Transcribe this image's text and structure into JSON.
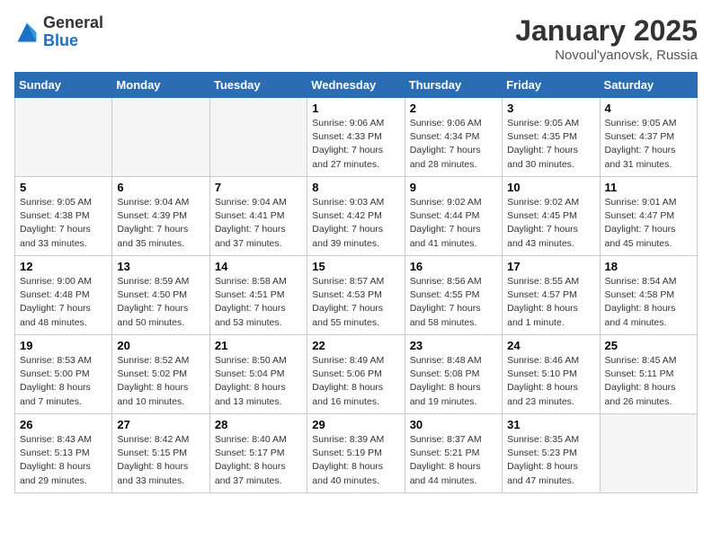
{
  "header": {
    "logo": {
      "line1": "General",
      "line2": "Blue"
    },
    "month_year": "January 2025",
    "location": "Novoul'yanovsk, Russia"
  },
  "weekdays": [
    "Sunday",
    "Monday",
    "Tuesday",
    "Wednesday",
    "Thursday",
    "Friday",
    "Saturday"
  ],
  "weeks": [
    [
      {
        "day": "",
        "empty": true
      },
      {
        "day": "",
        "empty": true
      },
      {
        "day": "",
        "empty": true
      },
      {
        "day": "1",
        "sunrise": "Sunrise: 9:06 AM",
        "sunset": "Sunset: 4:33 PM",
        "daylight": "Daylight: 7 hours and 27 minutes."
      },
      {
        "day": "2",
        "sunrise": "Sunrise: 9:06 AM",
        "sunset": "Sunset: 4:34 PM",
        "daylight": "Daylight: 7 hours and 28 minutes."
      },
      {
        "day": "3",
        "sunrise": "Sunrise: 9:05 AM",
        "sunset": "Sunset: 4:35 PM",
        "daylight": "Daylight: 7 hours and 30 minutes."
      },
      {
        "day": "4",
        "sunrise": "Sunrise: 9:05 AM",
        "sunset": "Sunset: 4:37 PM",
        "daylight": "Daylight: 7 hours and 31 minutes."
      }
    ],
    [
      {
        "day": "5",
        "sunrise": "Sunrise: 9:05 AM",
        "sunset": "Sunset: 4:38 PM",
        "daylight": "Daylight: 7 hours and 33 minutes."
      },
      {
        "day": "6",
        "sunrise": "Sunrise: 9:04 AM",
        "sunset": "Sunset: 4:39 PM",
        "daylight": "Daylight: 7 hours and 35 minutes."
      },
      {
        "day": "7",
        "sunrise": "Sunrise: 9:04 AM",
        "sunset": "Sunset: 4:41 PM",
        "daylight": "Daylight: 7 hours and 37 minutes."
      },
      {
        "day": "8",
        "sunrise": "Sunrise: 9:03 AM",
        "sunset": "Sunset: 4:42 PM",
        "daylight": "Daylight: 7 hours and 39 minutes."
      },
      {
        "day": "9",
        "sunrise": "Sunrise: 9:02 AM",
        "sunset": "Sunset: 4:44 PM",
        "daylight": "Daylight: 7 hours and 41 minutes."
      },
      {
        "day": "10",
        "sunrise": "Sunrise: 9:02 AM",
        "sunset": "Sunset: 4:45 PM",
        "daylight": "Daylight: 7 hours and 43 minutes."
      },
      {
        "day": "11",
        "sunrise": "Sunrise: 9:01 AM",
        "sunset": "Sunset: 4:47 PM",
        "daylight": "Daylight: 7 hours and 45 minutes."
      }
    ],
    [
      {
        "day": "12",
        "sunrise": "Sunrise: 9:00 AM",
        "sunset": "Sunset: 4:48 PM",
        "daylight": "Daylight: 7 hours and 48 minutes."
      },
      {
        "day": "13",
        "sunrise": "Sunrise: 8:59 AM",
        "sunset": "Sunset: 4:50 PM",
        "daylight": "Daylight: 7 hours and 50 minutes."
      },
      {
        "day": "14",
        "sunrise": "Sunrise: 8:58 AM",
        "sunset": "Sunset: 4:51 PM",
        "daylight": "Daylight: 7 hours and 53 minutes."
      },
      {
        "day": "15",
        "sunrise": "Sunrise: 8:57 AM",
        "sunset": "Sunset: 4:53 PM",
        "daylight": "Daylight: 7 hours and 55 minutes."
      },
      {
        "day": "16",
        "sunrise": "Sunrise: 8:56 AM",
        "sunset": "Sunset: 4:55 PM",
        "daylight": "Daylight: 7 hours and 58 minutes."
      },
      {
        "day": "17",
        "sunrise": "Sunrise: 8:55 AM",
        "sunset": "Sunset: 4:57 PM",
        "daylight": "Daylight: 8 hours and 1 minute."
      },
      {
        "day": "18",
        "sunrise": "Sunrise: 8:54 AM",
        "sunset": "Sunset: 4:58 PM",
        "daylight": "Daylight: 8 hours and 4 minutes."
      }
    ],
    [
      {
        "day": "19",
        "sunrise": "Sunrise: 8:53 AM",
        "sunset": "Sunset: 5:00 PM",
        "daylight": "Daylight: 8 hours and 7 minutes."
      },
      {
        "day": "20",
        "sunrise": "Sunrise: 8:52 AM",
        "sunset": "Sunset: 5:02 PM",
        "daylight": "Daylight: 8 hours and 10 minutes."
      },
      {
        "day": "21",
        "sunrise": "Sunrise: 8:50 AM",
        "sunset": "Sunset: 5:04 PM",
        "daylight": "Daylight: 8 hours and 13 minutes."
      },
      {
        "day": "22",
        "sunrise": "Sunrise: 8:49 AM",
        "sunset": "Sunset: 5:06 PM",
        "daylight": "Daylight: 8 hours and 16 minutes."
      },
      {
        "day": "23",
        "sunrise": "Sunrise: 8:48 AM",
        "sunset": "Sunset: 5:08 PM",
        "daylight": "Daylight: 8 hours and 19 minutes."
      },
      {
        "day": "24",
        "sunrise": "Sunrise: 8:46 AM",
        "sunset": "Sunset: 5:10 PM",
        "daylight": "Daylight: 8 hours and 23 minutes."
      },
      {
        "day": "25",
        "sunrise": "Sunrise: 8:45 AM",
        "sunset": "Sunset: 5:11 PM",
        "daylight": "Daylight: 8 hours and 26 minutes."
      }
    ],
    [
      {
        "day": "26",
        "sunrise": "Sunrise: 8:43 AM",
        "sunset": "Sunset: 5:13 PM",
        "daylight": "Daylight: 8 hours and 29 minutes."
      },
      {
        "day": "27",
        "sunrise": "Sunrise: 8:42 AM",
        "sunset": "Sunset: 5:15 PM",
        "daylight": "Daylight: 8 hours and 33 minutes."
      },
      {
        "day": "28",
        "sunrise": "Sunrise: 8:40 AM",
        "sunset": "Sunset: 5:17 PM",
        "daylight": "Daylight: 8 hours and 37 minutes."
      },
      {
        "day": "29",
        "sunrise": "Sunrise: 8:39 AM",
        "sunset": "Sunset: 5:19 PM",
        "daylight": "Daylight: 8 hours and 40 minutes."
      },
      {
        "day": "30",
        "sunrise": "Sunrise: 8:37 AM",
        "sunset": "Sunset: 5:21 PM",
        "daylight": "Daylight: 8 hours and 44 minutes."
      },
      {
        "day": "31",
        "sunrise": "Sunrise: 8:35 AM",
        "sunset": "Sunset: 5:23 PM",
        "daylight": "Daylight: 8 hours and 47 minutes."
      },
      {
        "day": "",
        "empty": true
      }
    ]
  ]
}
